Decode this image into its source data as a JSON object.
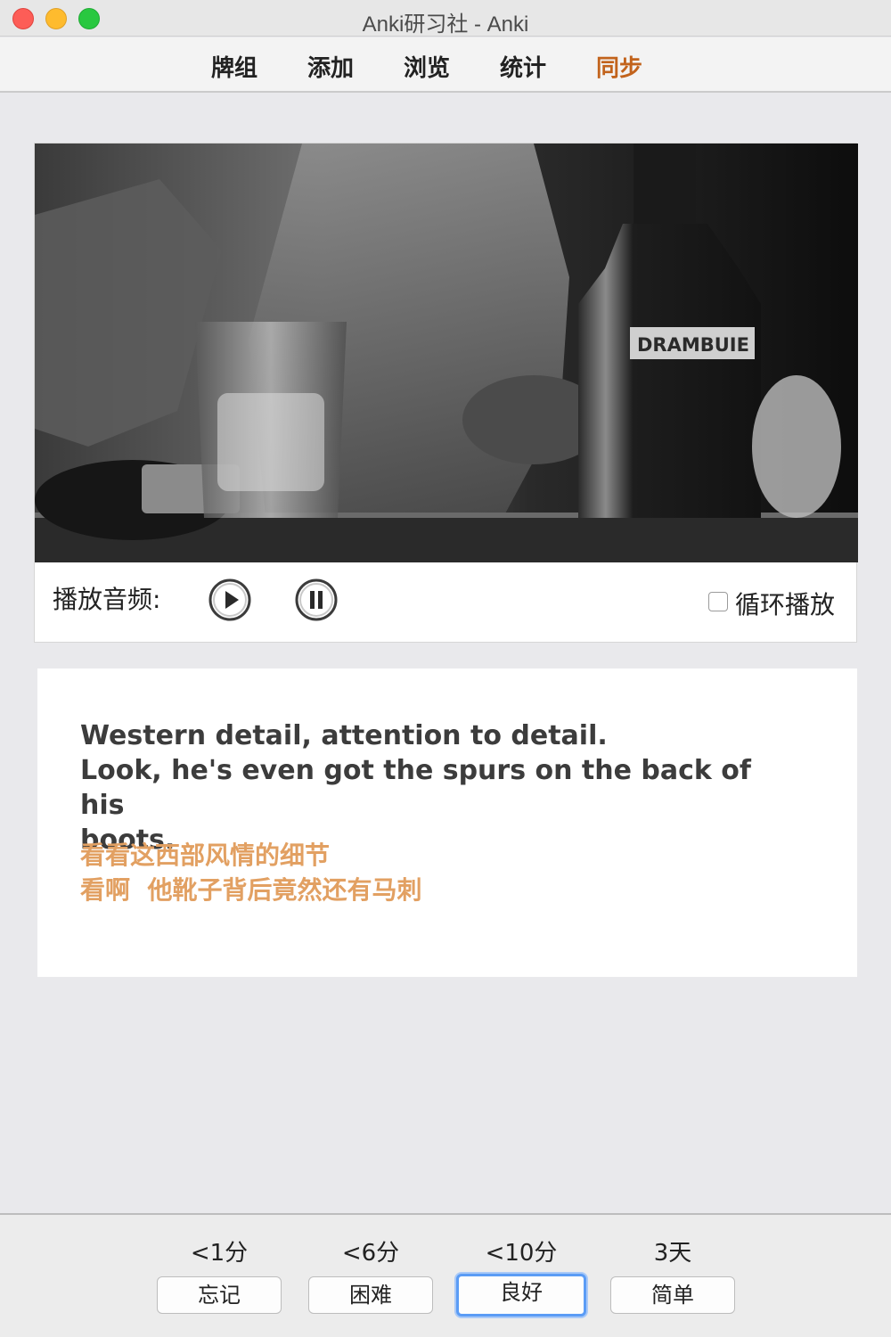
{
  "window": {
    "title": "Anki研习社 - Anki"
  },
  "toolbar": {
    "items": [
      {
        "label": "牌组"
      },
      {
        "label": "添加"
      },
      {
        "label": "浏览"
      },
      {
        "label": "统计"
      },
      {
        "label": "同步",
        "active": true
      }
    ],
    "active_color": "#c2631c"
  },
  "media": {
    "video_description_icon": "video-frame",
    "bottle_label": "DRAMBUIE",
    "audio_label": "播放音频:",
    "play_icon": "play-icon",
    "pause_icon": "pause-icon",
    "loop_label": "循环播放",
    "loop_checked": false
  },
  "card": {
    "english": [
      "Western detail, attention to detail.",
      "Look, he's even got the spurs on the back of his",
      "boots."
    ],
    "chinese": [
      "看看这西部风情的细节",
      "看啊  他靴子背后竟然还有马刺"
    ],
    "chinese_color": "#e2a062"
  },
  "answers": {
    "intervals": [
      "<1分",
      "<6分",
      "<10分",
      "3天"
    ],
    "buttons": [
      "忘记",
      "困难",
      "良好",
      "简单"
    ],
    "focused_index": 2
  }
}
